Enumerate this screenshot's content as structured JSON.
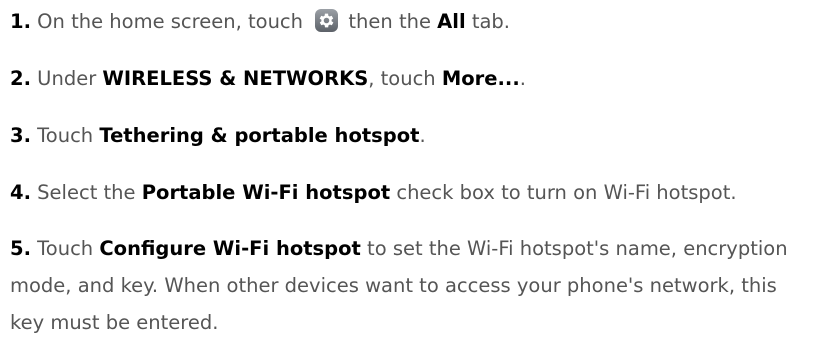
{
  "steps": [
    {
      "num": "1.",
      "p1": " On the home screen, touch ",
      "icon": "settings-gear-icon",
      "p2": " then the ",
      "b1": "All",
      "p3": " tab."
    },
    {
      "num": "2.",
      "p1": " Under ",
      "b1": "WIRELESS & NETWORKS",
      "p2": ", touch ",
      "b2": "More...",
      "p3": "."
    },
    {
      "num": "3.",
      "p1": " Touch ",
      "b1": "Tethering & portable hotspot",
      "p2": "."
    },
    {
      "num": "4.",
      "p1": " Select the ",
      "b1": "Portable Wi-Fi hotspot",
      "p2": " check box to turn on Wi-Fi hotspot."
    },
    {
      "num": "5.",
      "p1": " Touch ",
      "b1": "Configure Wi-Fi hotspot",
      "p2": " to set the Wi-Fi hotspot's name, encryption mode, and key. When other devices want to access your phone's network, this key must be entered."
    }
  ]
}
